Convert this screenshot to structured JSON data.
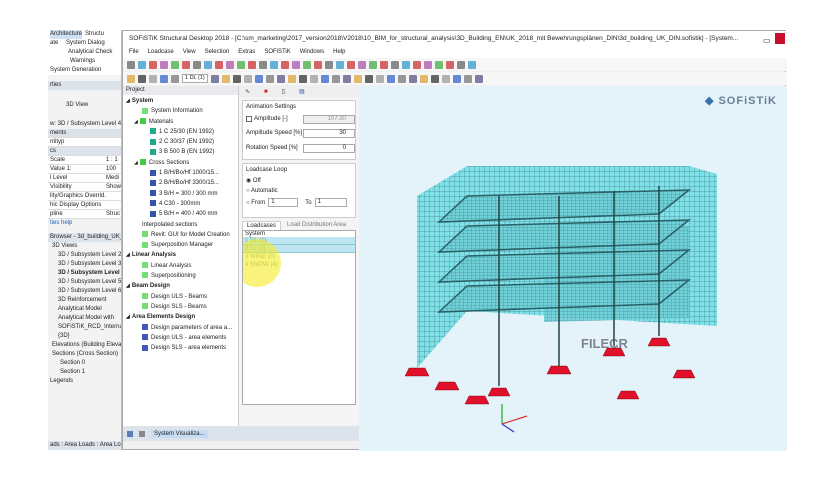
{
  "revit": {
    "tabs": [
      "Architecture",
      "Structu"
    ],
    "ribbon": [
      "System Dialog",
      "Analytical Check",
      "Warnings"
    ],
    "ribbon_group": "System Generation",
    "ribbon_left": "ate",
    "properties_title": "rties",
    "view_type": "3D View",
    "view_name": "w: 3D / Subsystem Level 4",
    "prop_rows": [
      {
        "k": "ments",
        "v": ""
      },
      {
        "k": "ntityp",
        "v": ""
      },
      {
        "k": "cs",
        "v": ""
      },
      {
        "k": "Scale",
        "v": "1 : 1"
      },
      {
        "k": "Value 1:",
        "v": "100"
      },
      {
        "k": "l Level",
        "v": "Medi"
      },
      {
        "k": "Visibility",
        "v": "Show"
      },
      {
        "k": "lity/Graphics Overrid...",
        "v": ""
      },
      {
        "k": "hic Display Options",
        "v": ""
      },
      {
        "k": "pline",
        "v": "Struc"
      }
    ],
    "help_link": "ties help",
    "browser_title": "Browser - 3d_building_UK_D",
    "tree": [
      "3D Views",
      "3D / Subsystem Level 2",
      "3D / Subsystem Level 3",
      "3D / Subsystem Level",
      "3D / Subsystem Level 5",
      "3D / Subsystem Level 6",
      "3D Reinforcement",
      "Analytical Model",
      "Analytical Model with",
      "SOFiSTiK_RCD_Internal",
      "{3D}",
      "Elevations (Building Elevat",
      "Sections (Cross Section)",
      "Section 0",
      "Section 1",
      "Legends"
    ],
    "status": "ads : Area Loads : Area Loa"
  },
  "window": {
    "title": "SOFiSTiK Structural Desktop 2018 - [C:\\sm_marketing\\2017_version2018\\V2018\\10_BIM_for_structural_analysis\\3D_Building_EN\\UK_2018_mit Bewehrungsplänen_DIN\\3d_building_UK_DIN.sofistik] - [System...",
    "menu": [
      "File",
      "Loadcase",
      "View",
      "Selection",
      "Extras",
      "SOFiSTiK",
      "Windows",
      "Help"
    ],
    "loadcase_select": "1 DL (1)"
  },
  "project": {
    "title": "Project",
    "items": [
      {
        "t": "System",
        "lvl": 0,
        "b": true
      },
      {
        "t": "System Information",
        "lvl": 2
      },
      {
        "t": "Materials",
        "lvl": 1
      },
      {
        "t": "1 C 25/30 (EN 1992)",
        "lvl": 3
      },
      {
        "t": "2 C 30/37 (EN 1992)",
        "lvl": 3
      },
      {
        "t": "3 B 500 B (EN 1992)",
        "lvl": 3
      },
      {
        "t": "Cross Sections",
        "lvl": 1
      },
      {
        "t": "1 B/H/Bo/Hf 1000/15...",
        "lvl": 3
      },
      {
        "t": "2 B/H/Bo/Hf 3300/15...",
        "lvl": 3
      },
      {
        "t": "3 B/H = 300 / 300 mm",
        "lvl": 3
      },
      {
        "t": "4 C30 - 300mm",
        "lvl": 3
      },
      {
        "t": "5 B/H = 400 / 400 mm",
        "lvl": 3
      },
      {
        "t": "Interpolated sections",
        "lvl": 2,
        "noicon": true
      },
      {
        "t": "Revit: GUI for Model Creation",
        "lvl": 2
      },
      {
        "t": "Superposition Manager",
        "lvl": 2
      },
      {
        "t": "Linear Analysis",
        "lvl": 0,
        "b": true
      },
      {
        "t": "Linear Analysis",
        "lvl": 2
      },
      {
        "t": "Superpositioning",
        "lvl": 2
      },
      {
        "t": "Beam Design",
        "lvl": 0,
        "b": true
      },
      {
        "t": "Design ULS - Beams",
        "lvl": 2
      },
      {
        "t": "Design SLS - Beams",
        "lvl": 2
      },
      {
        "t": "Area Elements Design",
        "lvl": 0,
        "b": true
      },
      {
        "t": "Design parameters of area a...",
        "lvl": 2
      },
      {
        "t": "Design ULS - area elements",
        "lvl": 2
      },
      {
        "t": "Design SLS - area elements",
        "lvl": 2
      }
    ],
    "bottom_tab": "System Visualiza..."
  },
  "settings": {
    "anim_title": "Animation Settings",
    "amplitude_label": "Amplitude [-]",
    "amplitude_value": "107.30",
    "amp_speed_label": "Amplitude Speed [%]",
    "amp_speed_value": "30",
    "amp_speed_pct": 30,
    "rot_speed_label": "Rotation Speed [%]",
    "rot_speed_value": "0",
    "loop_title": "Loadcase Loop",
    "off": "Off",
    "automatic": "Automatic",
    "from": "From",
    "from_val": "1",
    "to": "To",
    "to_val": "1",
    "tabs": [
      "Loadcases",
      "Load Distribution Area"
    ],
    "list_header": "System",
    "loadcases": [
      "1 DL (1)",
      "2 LL (2)",
      "3 WIND (3)",
      "4 SNOW (4)"
    ]
  },
  "viewport": {
    "logo": "SOFiSTiK",
    "watermark": "FILECR",
    "colors": {
      "mesh": "#7fe0e8",
      "support": "#e0102a",
      "bg": "#e4f2fa"
    }
  }
}
